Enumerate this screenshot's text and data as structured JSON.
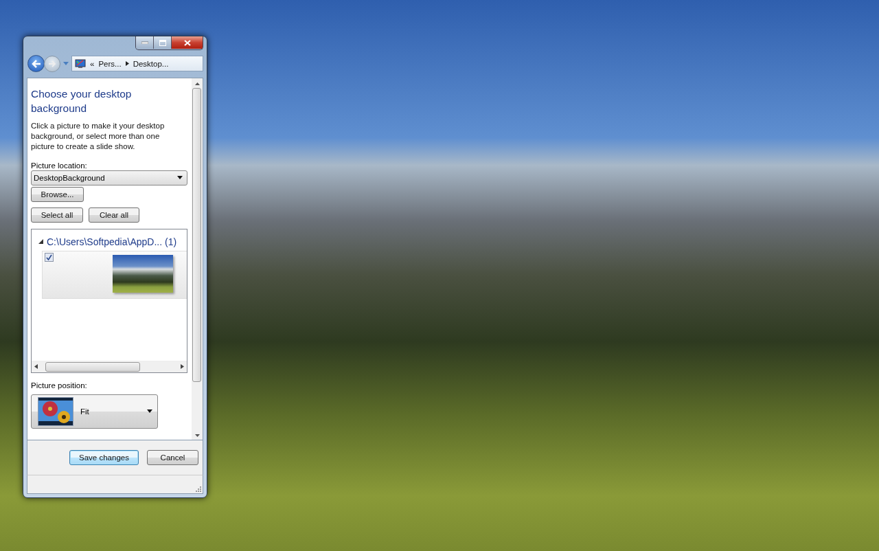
{
  "address_bar": {
    "prefix": "«",
    "items": [
      "Pers...",
      "Desktop..."
    ]
  },
  "heading": "Choose your desktop background",
  "description": "Click a picture to make it your desktop background, or select more than one picture to create a slide show.",
  "picture_location": {
    "label": "Picture location:",
    "value": "DesktopBackground"
  },
  "browse_button": "Browse...",
  "select_all_button": "Select all",
  "clear_all_button": "Clear all",
  "picture_group": {
    "title": "C:\\Users\\Softpedia\\AppD... (1)",
    "expanded": true,
    "pictures": [
      {
        "checked": true
      }
    ]
  },
  "picture_position": {
    "label": "Picture position:",
    "value": "Fit"
  },
  "buttons": [
    {
      "label": "Save changes",
      "default": true
    },
    {
      "label": "Cancel",
      "default": false
    }
  ]
}
